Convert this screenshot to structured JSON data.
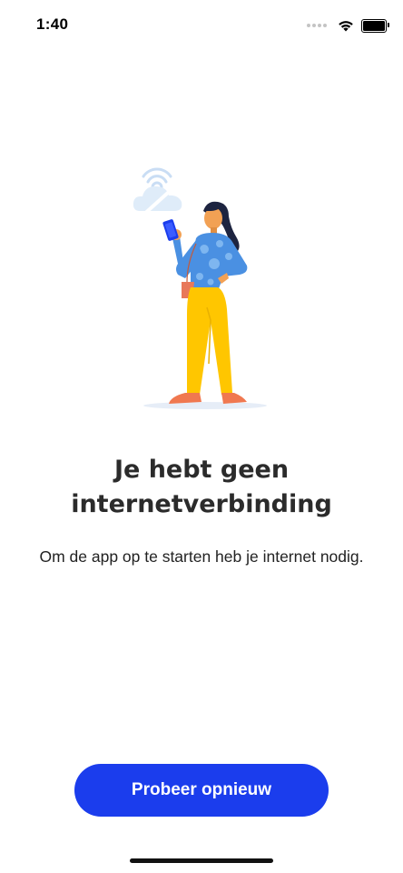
{
  "status_bar": {
    "time": "1:40",
    "battery_level": 1.0
  },
  "illustration": {
    "icons": [
      "no-wifi-cloud-icon",
      "person-with-phone-illustration"
    ]
  },
  "main": {
    "title": "Je hebt geen internetverbinding",
    "subtitle": "Om de app op te starten heb je internet nodig."
  },
  "actions": {
    "retry_label": "Probeer opnieuw"
  },
  "colors": {
    "primary_button": "#1b3ded",
    "title_text": "#2b2b2b"
  }
}
